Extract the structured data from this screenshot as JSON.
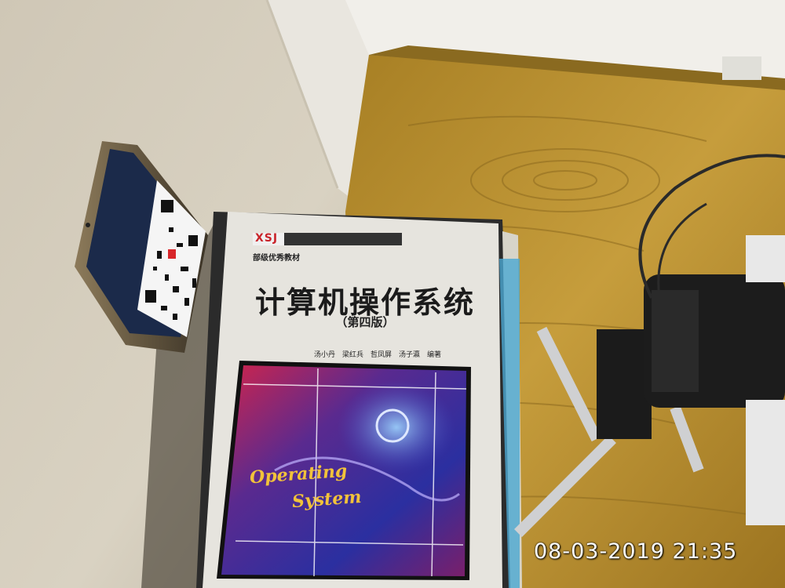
{
  "photo": {
    "timestamp": "08-03-2019 21:35",
    "book": {
      "logo": "XSJ",
      "series_label": "部级优秀教材",
      "title": "计算机操作系统",
      "edition": "（第四版）",
      "authors": "汤小丹　梁红兵　哲凤屏　汤子瀛　编著",
      "cover_text_line1": "Operating",
      "cover_text_line2": "System"
    },
    "colors": {
      "wall": "#d8d0bf",
      "desk": "#b8902e",
      "book_cover": "#e6e4de",
      "cover_art": "#3b2a7a",
      "timestamp": "#ffffff"
    }
  }
}
